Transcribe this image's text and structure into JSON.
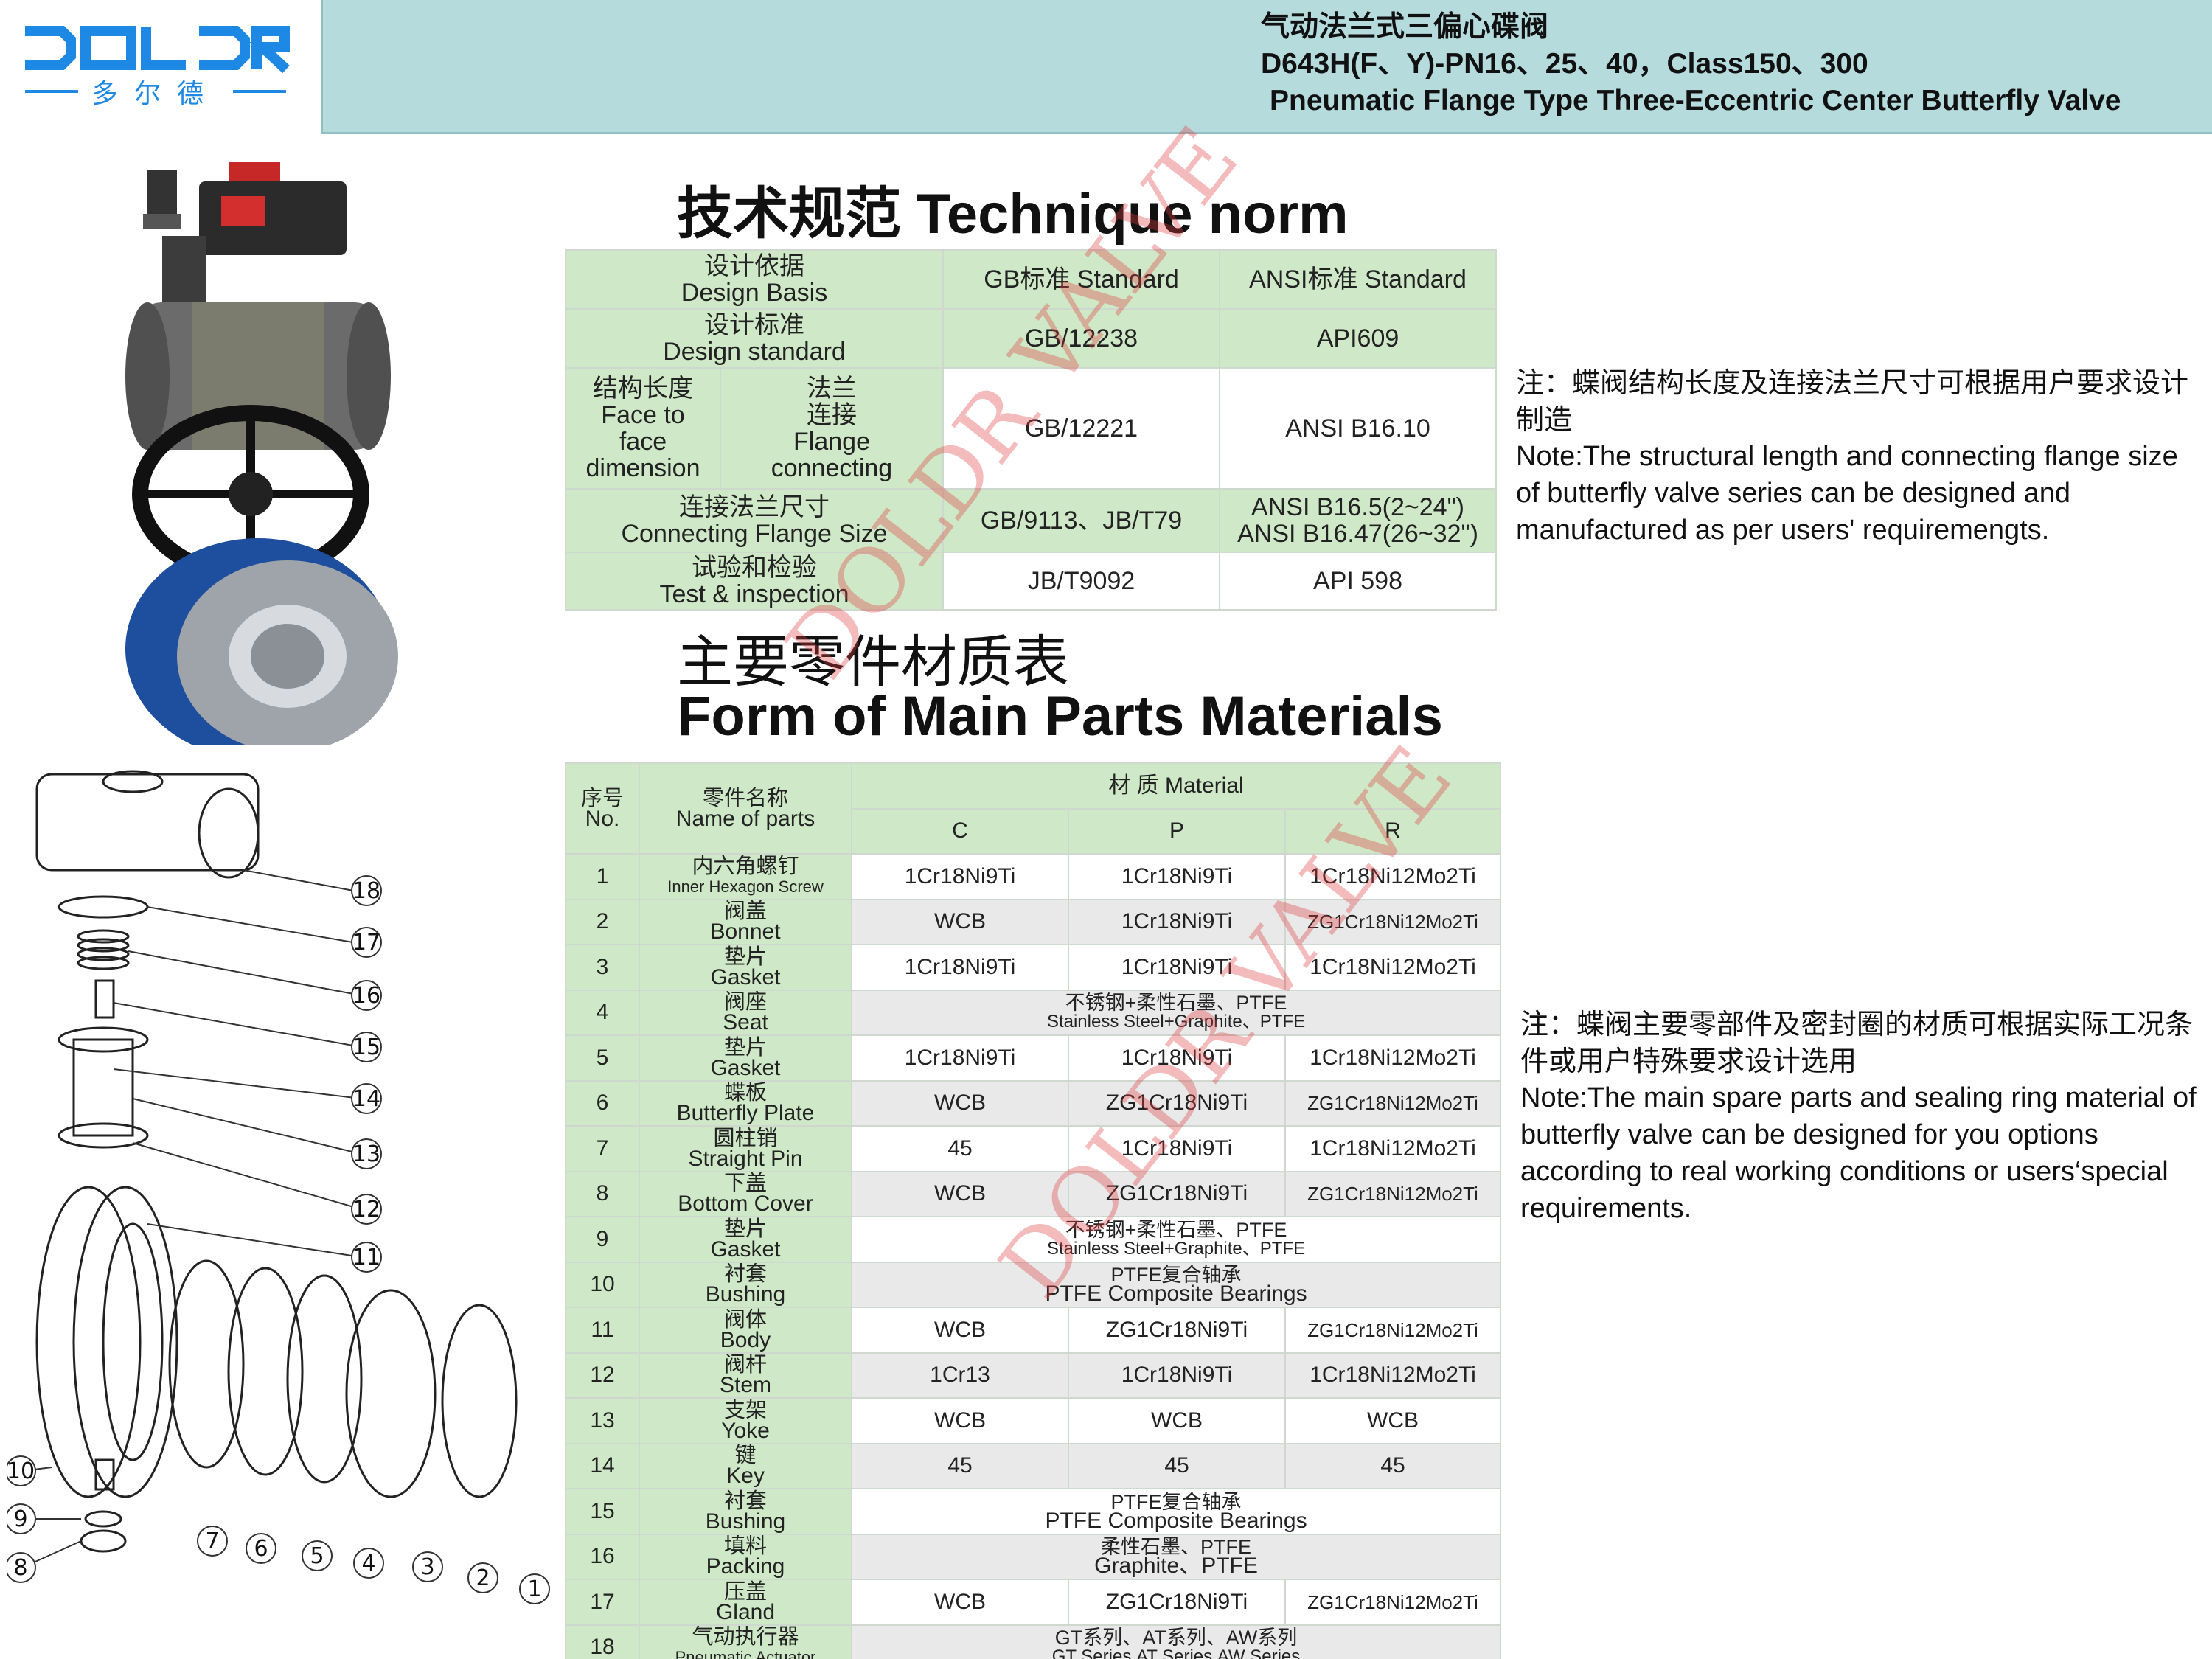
{
  "brand": {
    "logo_text": "DOLDR",
    "logo_sub": "多尔德",
    "color": "#1e88e5"
  },
  "header": {
    "title_cn": "气动法兰式三偏心碟阀",
    "model": "D643H(F、Y)-PN16、25、40，Class150、300",
    "title_en": "Pneumatic Flange Type Three-Eccentric Center Butterfly Valve"
  },
  "section1_title": "技术规范 Technique norm",
  "spec_table": {
    "head": {
      "label": [
        "设计依据",
        "Design Basis"
      ],
      "gb": "GB标准 Standard",
      "ansi": "ANSI标准 Standard"
    },
    "design_standard": {
      "label": [
        "设计标准",
        "Design standard"
      ],
      "gb": "GB/12238",
      "ansi": "API609"
    },
    "face_flange": {
      "face_label": [
        "结构长度",
        "Face to",
        "face",
        "dimension"
      ],
      "flange_label": [
        "法兰",
        "连接",
        "Flange",
        "connecting"
      ],
      "gb": "GB/12221",
      "ansi": "ANSI B16.10"
    },
    "flange_size": {
      "label": [
        "连接法兰尺寸",
        "Connecting Flange Size"
      ],
      "gb": "GB/9113、JB/T79",
      "ansi": [
        "ANSI B16.5(2~24\")",
        "ANSI B16.47(26~32\")"
      ]
    },
    "test": {
      "label": [
        "试验和检验",
        "Test & inspection"
      ],
      "gb": "JB/T9092",
      "ansi": "API 598"
    }
  },
  "section2_title_cn": "主要零件材质表",
  "section2_title_en": "Form of Main Parts Materials",
  "materials_table": {
    "col_no": [
      "序号",
      "No."
    ],
    "col_name": [
      "零件名称",
      "Name of parts"
    ],
    "col_material": "材 质 Material",
    "cols": [
      "C",
      "P",
      "R"
    ],
    "rows": [
      {
        "no": "1",
        "cn": "内六角螺钉",
        "en": "Inner Hexagon Screw",
        "c": "1Cr18Ni9Ti",
        "p": "1Cr18Ni9Ti",
        "r": "1Cr18Ni12Mo2Ti"
      },
      {
        "no": "2",
        "cn": "阀盖",
        "en": "Bonnet",
        "c": "WCB",
        "p": "1Cr18Ni9Ti",
        "r": "ZG1Cr18Ni12Mo2Ti"
      },
      {
        "no": "3",
        "cn": "垫片",
        "en": "Gasket",
        "c": "1Cr18Ni9Ti",
        "p": "1Cr18Ni9Ti",
        "r": "1Cr18Ni12Mo2Ti"
      },
      {
        "no": "4",
        "cn": "阀座",
        "en": "Seat",
        "span_cn": "不锈钢+柔性石墨、PTFE",
        "span_en": "Stainless Steel+Graphite、PTFE"
      },
      {
        "no": "5",
        "cn": "垫片",
        "en": "Gasket",
        "c": "1Cr18Ni9Ti",
        "p": "1Cr18Ni9Ti",
        "r": "1Cr18Ni12Mo2Ti"
      },
      {
        "no": "6",
        "cn": "蝶板",
        "en": "Butterfly Plate",
        "c": "WCB",
        "p": "ZG1Cr18Ni9Ti",
        "r": "ZG1Cr18Ni12Mo2Ti"
      },
      {
        "no": "7",
        "cn": "圆柱销",
        "en": "Straight Pin",
        "c": "45",
        "p": "1Cr18Ni9Ti",
        "r": "1Cr18Ni12Mo2Ti"
      },
      {
        "no": "8",
        "cn": "下盖",
        "en": "Bottom Cover",
        "c": "WCB",
        "p": "ZG1Cr18Ni9Ti",
        "r": "ZG1Cr18Ni12Mo2Ti"
      },
      {
        "no": "9",
        "cn": "垫片",
        "en": "Gasket",
        "span_cn": "不锈钢+柔性石墨、PTFE",
        "span_en": "Stainless Steel+Graphite、PTFE"
      },
      {
        "no": "10",
        "cn": "衬套",
        "en": "Bushing",
        "span_cn": "PTFE复合轴承",
        "span_en": "PTFE Composite Bearings"
      },
      {
        "no": "11",
        "cn": "阀体",
        "en": "Body",
        "c": "WCB",
        "p": "ZG1Cr18Ni9Ti",
        "r": "ZG1Cr18Ni12Mo2Ti"
      },
      {
        "no": "12",
        "cn": "阀杆",
        "en": "Stem",
        "c": "1Cr13",
        "p": "1Cr18Ni9Ti",
        "r": "1Cr18Ni12Mo2Ti"
      },
      {
        "no": "13",
        "cn": "支架",
        "en": "Yoke",
        "c": "WCB",
        "p": "WCB",
        "r": "WCB"
      },
      {
        "no": "14",
        "cn": "键",
        "en": "Key",
        "c": "45",
        "p": "45",
        "r": "45"
      },
      {
        "no": "15",
        "cn": "衬套",
        "en": "Bushing",
        "span_cn": "PTFE复合轴承",
        "span_en": "PTFE Composite Bearings"
      },
      {
        "no": "16",
        "cn": "填料",
        "en": "Packing",
        "span_cn": "柔性石墨、PTFE",
        "span_en": "Graphite、PTFE"
      },
      {
        "no": "17",
        "cn": "压盖",
        "en": "Gland",
        "c": "WCB",
        "p": "ZG1Cr18Ni9Ti",
        "r": "ZG1Cr18Ni12Mo2Ti"
      },
      {
        "no": "18",
        "cn": "气动执行器",
        "en": "Pneumatic Actuator",
        "span_cn": "GT系列、AT系列、AW系列",
        "span_en": "GT Series,AT Series,AW Series"
      }
    ]
  },
  "note1": {
    "cn": "注：蝶阀结构长度及连接法兰尺寸可根据用户要求设计制造",
    "en": "Note:The structural length and connecting flange size of butterfly valve series can be designed and manufactured as per users' requiremengts."
  },
  "note2": {
    "cn": "注：蝶阀主要零部件及密封圈的材质可根据实际工况条件或用户特殊要求设计选用",
    "en": "Note:The main spare parts and sealing ring material of butterfly valve can be designed for you options according to real working conditions or users‘special requirements."
  },
  "watermark": "DOLDR VALVE",
  "diagram_callouts": [
    "1",
    "2",
    "3",
    "4",
    "5",
    "6",
    "7",
    "8",
    "9",
    "10",
    "11",
    "12",
    "13",
    "14",
    "15",
    "16",
    "17",
    "18"
  ]
}
